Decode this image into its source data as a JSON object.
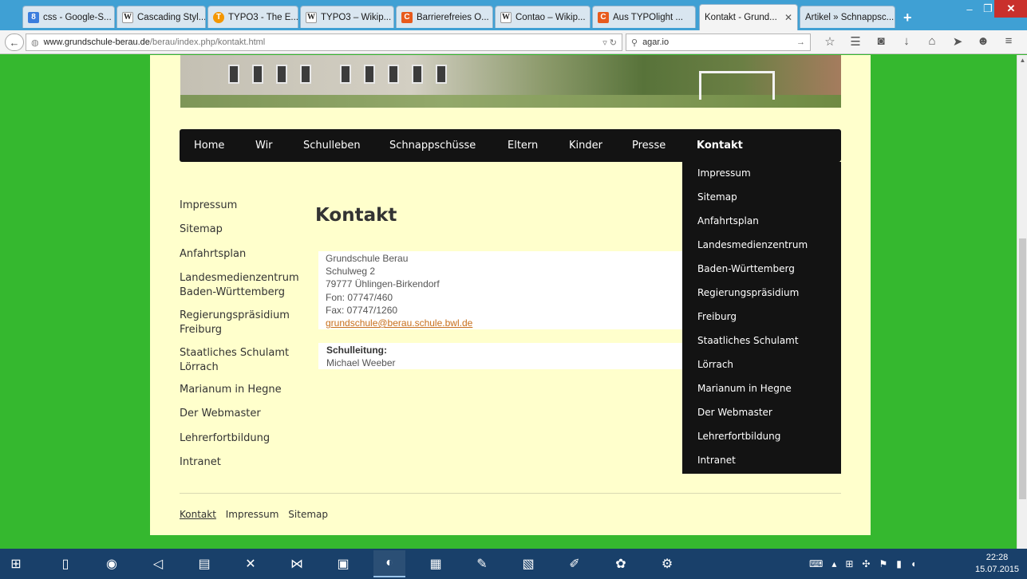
{
  "browser": {
    "tabs": [
      {
        "label": "css - Google-S...",
        "fav": "g",
        "fav_glyph": "8"
      },
      {
        "label": "Cascading Styl...",
        "fav": "w",
        "fav_glyph": "W"
      },
      {
        "label": "TYPO3 - The E...",
        "fav": "t",
        "fav_glyph": "T"
      },
      {
        "label": "TYPO3 – Wikip...",
        "fav": "w",
        "fav_glyph": "W"
      },
      {
        "label": "Barrierefreies O...",
        "fav": "c",
        "fav_glyph": "C"
      },
      {
        "label": "Contao – Wikip...",
        "fav": "w",
        "fav_glyph": "W"
      },
      {
        "label": "Aus TYPOlight ...",
        "fav": "c",
        "fav_glyph": "C"
      },
      {
        "label": "Kontakt - Grund...",
        "fav": "none",
        "fav_glyph": "",
        "active": true
      },
      {
        "label": "Artikel » Schnappsc...",
        "fav": "none",
        "fav_glyph": ""
      }
    ],
    "url_host": "www.grundschule-berau.de",
    "url_path": "/berau/index.php/kontakt.html",
    "search_text": "agar.io"
  },
  "site": {
    "menu": [
      "Home",
      "Wir",
      "Schulleben",
      "Schnappschüsse",
      "Eltern",
      "Kinder",
      "Presse",
      "Kontakt"
    ],
    "dropdown": [
      "Impressum",
      "Sitemap",
      "Anfahrtsplan",
      "Landesmedienzentrum",
      "Baden-Württemberg",
      "Regierungspräsidium",
      "Freiburg",
      "Staatliches Schulamt",
      "Lörrach",
      "Marianum in Hegne",
      "Der Webmaster",
      "Lehrerfortbildung",
      "Intranet"
    ],
    "sidenav": [
      "Impressum",
      "Sitemap",
      "Anfahrtsplan",
      "Landesmedienzentrum Baden-Württemberg",
      "Regierungspräsidium Freiburg",
      "Staatliches Schulamt Lörrach",
      "Marianum in Hegne",
      "Der Webmaster",
      "Lehrerfortbildung",
      "Intranet"
    ],
    "title": "Kontakt",
    "address": [
      "Grundschule Berau",
      "Schulweg 2",
      "79777 Ühlingen-Birkendorf",
      "Fon: 07747/460",
      "Fax: 07747/1260"
    ],
    "email": "grundschule@berau.schule.bwl.de",
    "leitung_label": "Schulleitung:",
    "leitung_name": "Michael Weeber",
    "footer": [
      "Kontakt",
      "Impressum",
      "Sitemap"
    ]
  },
  "taskbar": {
    "time": "22:28",
    "date": "15.07.2015"
  }
}
